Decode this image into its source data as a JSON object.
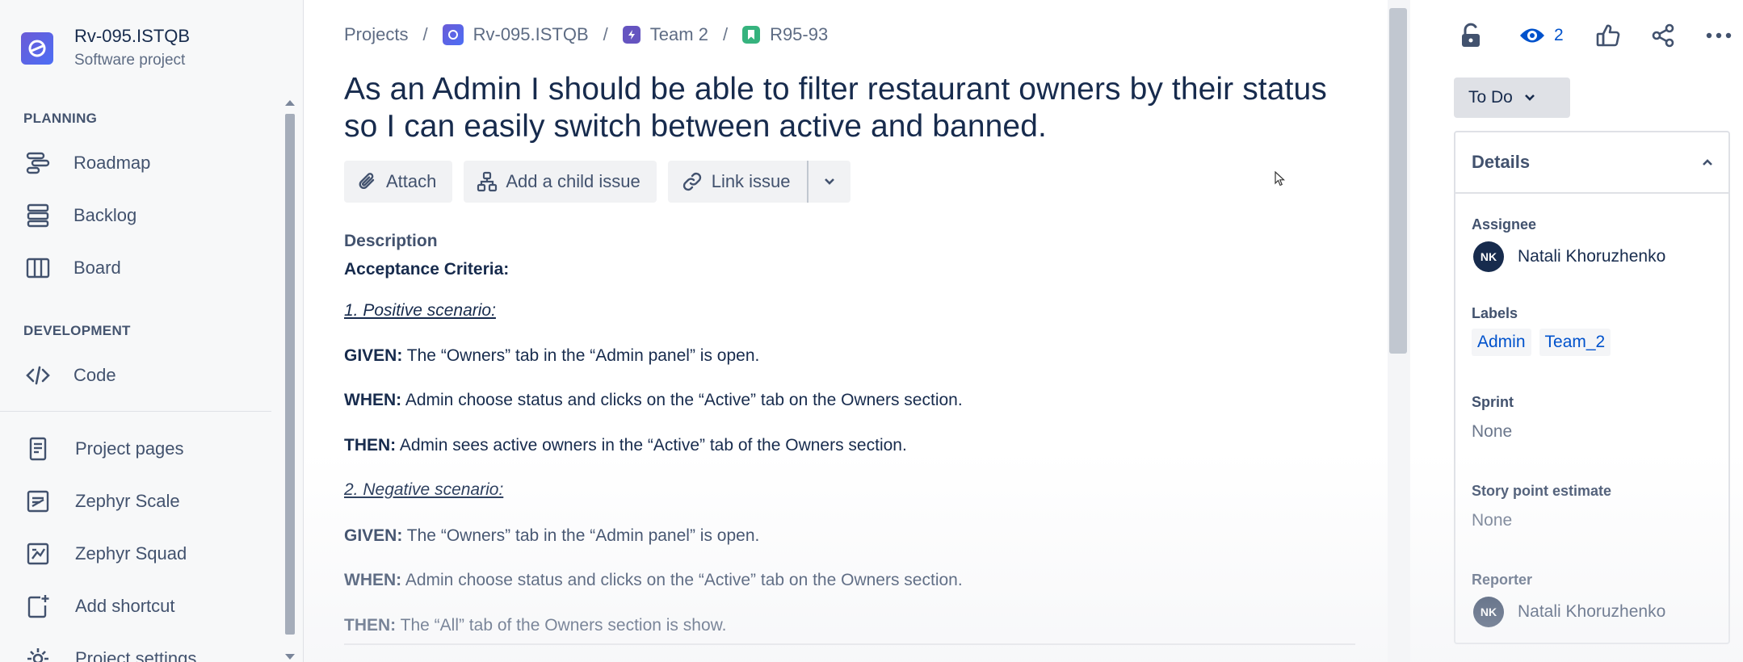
{
  "sidebar": {
    "project_name": "Rv-095.ISTQB",
    "project_type": "Software project",
    "planning_heading": "PLANNING",
    "development_heading": "DEVELOPMENT",
    "items": [
      {
        "label": "Roadmap",
        "icon": "roadmap-icon"
      },
      {
        "label": "Backlog",
        "icon": "backlog-icon"
      },
      {
        "label": "Board",
        "icon": "board-icon"
      },
      {
        "label": "Code",
        "icon": "code-icon"
      },
      {
        "label": "Project pages",
        "icon": "page-icon"
      },
      {
        "label": "Zephyr Scale",
        "icon": "zephyr-scale-icon"
      },
      {
        "label": "Zephyr Squad",
        "icon": "zephyr-squad-icon"
      },
      {
        "label": "Add shortcut",
        "icon": "add-shortcut-icon"
      },
      {
        "label": "Project settings",
        "icon": "gear-icon"
      }
    ]
  },
  "breadcrumbs": {
    "projects": "Projects",
    "project": "Rv-095.ISTQB",
    "epic": "Team 2",
    "issue": "R95-93"
  },
  "issue": {
    "title": "As an Admin I should be able to filter restaurant owners by their status so I can easily switch between active and banned."
  },
  "actions": {
    "attach": "Attach",
    "add_child": "Add a child issue",
    "link_issue": "Link issue"
  },
  "description": {
    "label": "Description",
    "criteria_heading": "Acceptance Criteria:",
    "scenario1_title": "1. Positive scenario:",
    "s1_given_kw": "GIVEN:",
    "s1_given": " The “Owners” tab in the “Admin panel” is open.",
    "s1_when_kw": "WHEN:",
    "s1_when": " Admin choose status and clicks on the “Active” tab on the Owners section.",
    "s1_then_kw": "THEN:",
    "s1_then": " Admin sees active owners in the “Active” tab of the Owners section.",
    "scenario2_title": "2. Negative scenario:",
    "s2_given_kw": "GIVEN:",
    "s2_given": " The “Owners” tab in the “Admin panel” is open.",
    "s2_when_kw": "WHEN:",
    "s2_when": " Admin choose status and clicks on the “Active” tab on the Owners section.",
    "s2_then_kw": "THEN:",
    "s2_then": " The “All” tab of the Owners section is show."
  },
  "topbar": {
    "watch_count": "2"
  },
  "status": {
    "label": "To Do"
  },
  "details": {
    "heading": "Details",
    "assignee_label": "Assignee",
    "assignee_initials": "NK",
    "assignee_name": "Natali Khoruzhenko",
    "labels_label": "Labels",
    "labels": [
      "Admin",
      "Team_2"
    ],
    "sprint_label": "Sprint",
    "sprint_value": "None",
    "story_points_label": "Story point estimate",
    "story_points_value": "None",
    "reporter_label": "Reporter",
    "reporter_initials": "NK",
    "reporter_name": "Natali Khoruzhenko"
  },
  "colors": {
    "accent": "#0052cc",
    "text": "#172b4d",
    "subtle": "#42526e",
    "story": "#36b37e",
    "epic": "#6554c0"
  }
}
